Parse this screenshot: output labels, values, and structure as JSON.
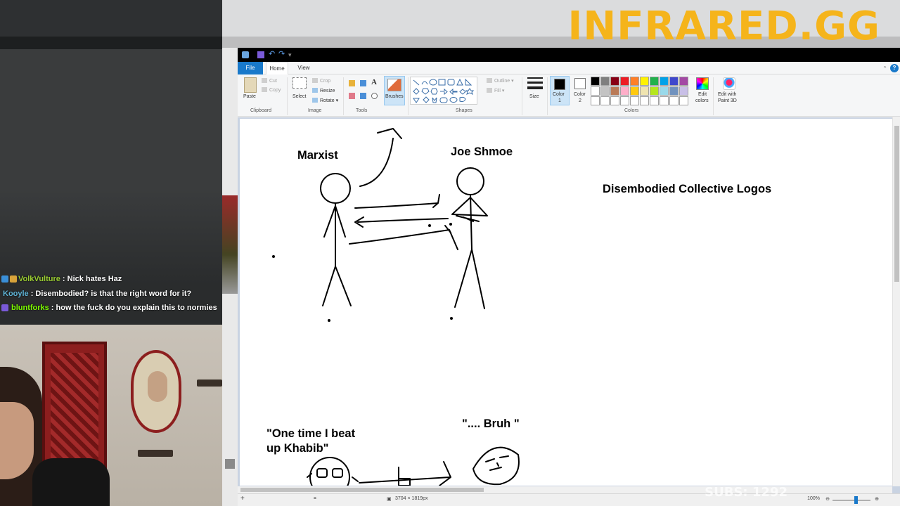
{
  "brand": {
    "logo_text": "INFRARED.GG",
    "accent": "#f5b41b"
  },
  "chat": {
    "messages": [
      {
        "user": "VolkVulture",
        "user_color": "#9acd32",
        "text": ": Nick hates Haz",
        "badges": [
          "blue",
          "gold"
        ]
      },
      {
        "user": "Kooyle",
        "user_color": "#5fb4d6",
        "text": ": Disembodied? is that the right word for it?",
        "badges": []
      },
      {
        "user": "bluntforks",
        "user_color": "#7cfc00",
        "text": ": how the fuck do you explain this to normies",
        "badges": [
          "purple"
        ]
      }
    ]
  },
  "paint": {
    "menu": {
      "file": "File",
      "home": "Home",
      "view": "View"
    },
    "clipboard": {
      "paste": "Paste",
      "cut": "Cut",
      "copy": "Copy",
      "label": "Clipboard"
    },
    "image": {
      "select": "Select",
      "crop": "Crop",
      "resize": "Resize",
      "rotate": "Rotate",
      "label": "Image"
    },
    "tools": {
      "label": "Tools",
      "brushes": "Brushes"
    },
    "shapes": {
      "outline": "Outline",
      "fill": "Fill",
      "label": "Shapes"
    },
    "size": {
      "label": "Size"
    },
    "colors": {
      "color1_line1": "Color",
      "color1_line2": "1",
      "color2_line1": "Color",
      "color2_line2": "2",
      "label": "Colors",
      "edit_line1": "Edit",
      "edit_line2": "colors",
      "paint3d_line1": "Edit with",
      "paint3d_line2": "Paint 3D",
      "palette": [
        "#000000",
        "#7f7f7f",
        "#880015",
        "#ed1c24",
        "#ff7f27",
        "#fff200",
        "#22b14c",
        "#00a2e8",
        "#3f48cc",
        "#a349a4",
        "#ffffff",
        "#c3c3c3",
        "#b97a57",
        "#ffaec9",
        "#ffc90e",
        "#efe4b0",
        "#b5e61d",
        "#99d9ea",
        "#7092be",
        "#c8bfe7",
        "#ffffff",
        "#ffffff",
        "#ffffff",
        "#ffffff",
        "#ffffff",
        "#ffffff",
        "#ffffff",
        "#ffffff",
        "#ffffff",
        "#ffffff"
      ]
    },
    "canvas_texts": {
      "marxist": "Marxist",
      "joe": "Joe Shmoe",
      "logos": "Disembodied Collective Logos",
      "beat_line1": "\"One time I beat",
      "beat_line2": "up Khabib\"",
      "bruh": "\".... Bruh \""
    },
    "status": {
      "dimensions": "3704 × 1819px",
      "zoom": "100%"
    }
  },
  "overlay": {
    "subs": "SUBS: 1292"
  }
}
